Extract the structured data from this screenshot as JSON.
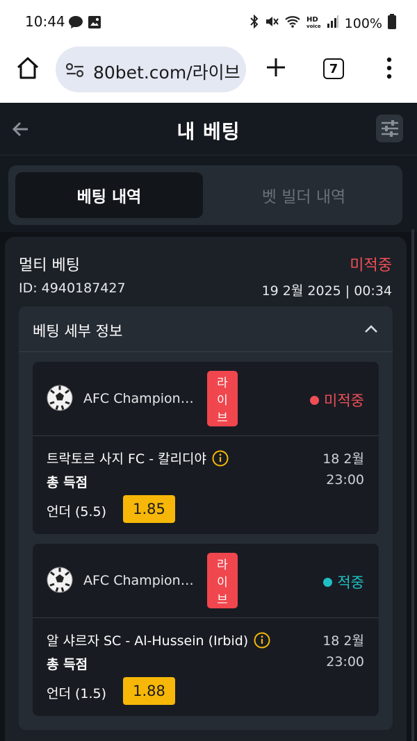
{
  "status_bar": {
    "time": "10:44",
    "battery": "100%"
  },
  "browser": {
    "url": "80bet.com/라이브",
    "tab_count": "7"
  },
  "header": {
    "title": "내 베팅"
  },
  "tabs": [
    {
      "label": "베팅 내역",
      "active": true
    },
    {
      "label": "벳 빌더 내역",
      "active": false
    }
  ],
  "bet": {
    "type": "멀티 베팅",
    "status": "미적중",
    "id": "ID: 4940187427",
    "date": "19 2월 2025 | 00:34",
    "details_title": "베팅 세부 정보",
    "selections": [
      {
        "league": "AFC Champion…",
        "live_chars": [
          "라",
          "이",
          "브"
        ],
        "status": "미적중",
        "status_color": "#f04e57",
        "match": "트락토르 사지 FC - 칼리디야",
        "date": "18 2월",
        "time": "23:00",
        "market": "총 득점",
        "pick": "언더 (5.5)",
        "odds": "1.85"
      },
      {
        "league": "AFC Champion…",
        "live_chars": [
          "라",
          "이",
          "브"
        ],
        "status": "적중",
        "status_color": "#1fbfc4",
        "match": "알 샤르자 SC - Al-Hussein (Irbid)",
        "date": "18 2월",
        "time": "23:00",
        "market": "총 득점",
        "pick": "언더 (1.5)",
        "odds": "1.88"
      }
    ]
  },
  "colors": {
    "lost": "#f04e57",
    "won": "#1fbfc4",
    "odds_bg": "#f6b708",
    "live_badge": "#f0464d"
  }
}
